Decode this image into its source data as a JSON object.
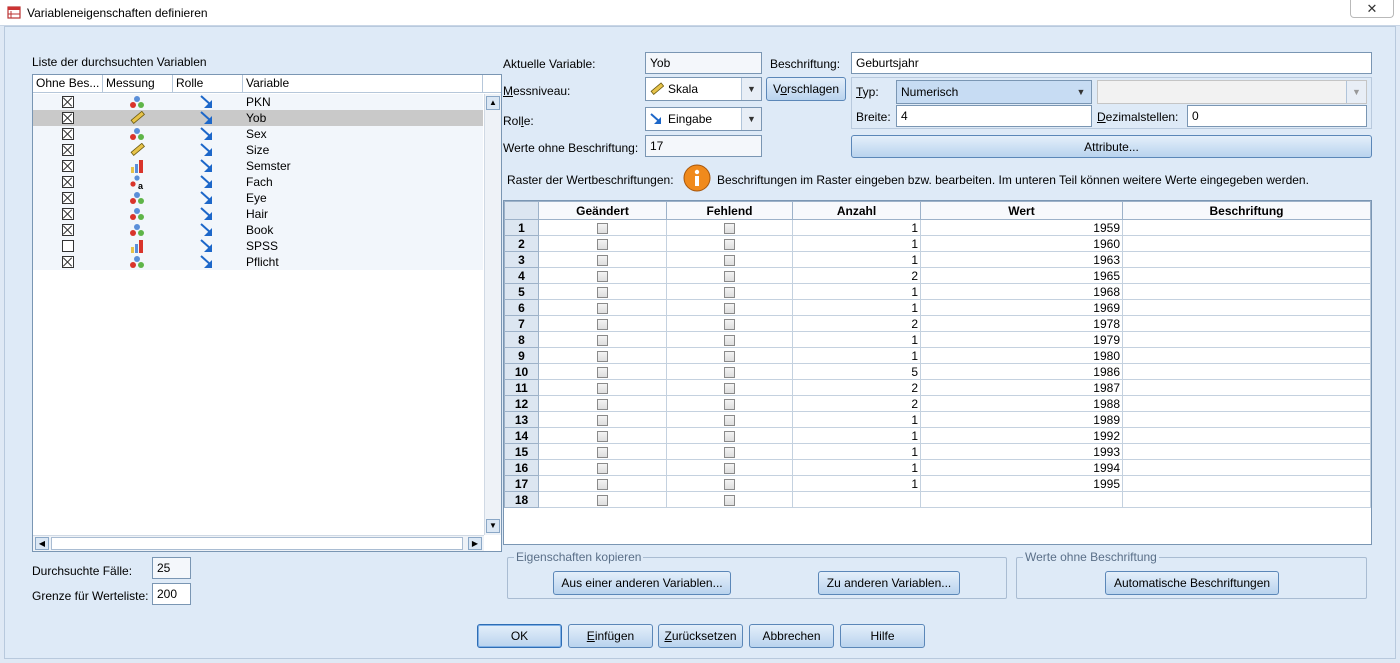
{
  "window": {
    "title": "Variableneigenschaften definieren",
    "close_glyph": "✕"
  },
  "left": {
    "list_title": "Liste der durchsuchten Variablen",
    "columns": [
      "Ohne Bes...",
      "Messung",
      "Rolle",
      "Variable"
    ],
    "variables": [
      {
        "name": "PKN",
        "checked": true,
        "measure": "nominal-icon",
        "role": "input-icon"
      },
      {
        "name": "Yob",
        "checked": true,
        "measure": "scale-icon",
        "role": "input-icon",
        "selected": true
      },
      {
        "name": "Sex",
        "checked": true,
        "measure": "nominal-icon",
        "role": "input-icon"
      },
      {
        "name": "Size",
        "checked": true,
        "measure": "scale-icon",
        "role": "input-icon"
      },
      {
        "name": "Semster",
        "checked": true,
        "measure": "ordinal-icon",
        "role": "input-icon"
      },
      {
        "name": "Fach",
        "checked": true,
        "measure": "nominal-string-icon",
        "role": "input-icon"
      },
      {
        "name": "Eye",
        "checked": true,
        "measure": "nominal-icon",
        "role": "input-icon"
      },
      {
        "name": "Hair",
        "checked": true,
        "measure": "nominal-icon",
        "role": "input-icon"
      },
      {
        "name": "Book",
        "checked": true,
        "measure": "nominal-icon",
        "role": "input-icon"
      },
      {
        "name": "SPSS",
        "checked": false,
        "measure": "ordinal-icon",
        "role": "input-icon"
      },
      {
        "name": "Pflicht",
        "checked": true,
        "measure": "nominal-icon",
        "role": "input-icon"
      }
    ],
    "cases_label": "Durchsuchte Fälle:",
    "cases_value": "25",
    "limit_label": "Grenze für Werteliste:",
    "limit_value": "200"
  },
  "props": {
    "current_var_label": "Aktuelle Variable:",
    "current_var_value": "Yob",
    "label_label": "Beschriftung:",
    "label_value": "Geburtsjahr",
    "measure_label": "Messniveau:",
    "measure_value": "Skala",
    "suggest_button": "Vorschlagen",
    "type_label": "Typ:",
    "type_value": "Numerisch",
    "type_extra_value": "",
    "width_label": "Breite:",
    "width_value": "4",
    "decimals_label": "Dezimalstellen:",
    "decimals_value": "0",
    "role_label": "Rolle:",
    "role_value": "Eingabe",
    "attributes_button": "Attribute...",
    "unlabeled_label": "Werte ohne Beschriftung:",
    "unlabeled_value": "17",
    "grid_label": "Raster der Wertbeschriftungen:",
    "info_text": "Beschriftungen im Raster eingeben bzw. bearbeiten. Im unteren Teil können weitere Werte eingegeben werden."
  },
  "grid": {
    "headers": [
      "Geändert",
      "Fehlend",
      "Anzahl",
      "Wert",
      "Beschriftung"
    ],
    "rows": [
      {
        "n": "1",
        "count": "1",
        "value": "1959",
        "label": ""
      },
      {
        "n": "2",
        "count": "1",
        "value": "1960",
        "label": ""
      },
      {
        "n": "3",
        "count": "1",
        "value": "1963",
        "label": ""
      },
      {
        "n": "4",
        "count": "2",
        "value": "1965",
        "label": ""
      },
      {
        "n": "5",
        "count": "1",
        "value": "1968",
        "label": ""
      },
      {
        "n": "6",
        "count": "1",
        "value": "1969",
        "label": ""
      },
      {
        "n": "7",
        "count": "2",
        "value": "1978",
        "label": ""
      },
      {
        "n": "8",
        "count": "1",
        "value": "1979",
        "label": ""
      },
      {
        "n": "9",
        "count": "1",
        "value": "1980",
        "label": ""
      },
      {
        "n": "10",
        "count": "5",
        "value": "1986",
        "label": ""
      },
      {
        "n": "11",
        "count": "2",
        "value": "1987",
        "label": ""
      },
      {
        "n": "12",
        "count": "2",
        "value": "1988",
        "label": ""
      },
      {
        "n": "13",
        "count": "1",
        "value": "1989",
        "label": ""
      },
      {
        "n": "14",
        "count": "1",
        "value": "1992",
        "label": ""
      },
      {
        "n": "15",
        "count": "1",
        "value": "1993",
        "label": ""
      },
      {
        "n": "16",
        "count": "1",
        "value": "1994",
        "label": ""
      },
      {
        "n": "17",
        "count": "1",
        "value": "1995",
        "label": ""
      },
      {
        "n": "18",
        "count": "",
        "value": "",
        "label": ""
      }
    ]
  },
  "copy_group": {
    "title": "Eigenschaften kopieren",
    "from_button": "Aus einer anderen Variablen...",
    "to_button": "Zu anderen Variablen..."
  },
  "unlabeled_group": {
    "title": "Werte ohne Beschriftung",
    "auto_button": "Automatische Beschriftungen"
  },
  "footer": {
    "ok": "OK",
    "paste": "Einfügen",
    "reset": "Zurücksetzen",
    "cancel": "Abbrechen",
    "help": "Hilfe"
  }
}
